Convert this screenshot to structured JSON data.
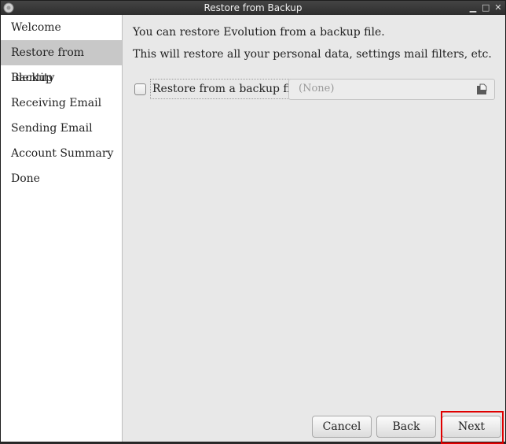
{
  "window": {
    "title": "Restore from Backup"
  },
  "sidebar": {
    "items": [
      {
        "label": "Welcome"
      },
      {
        "label": "Restore from Backup"
      },
      {
        "label": "Identity"
      },
      {
        "label": "Receiving Email"
      },
      {
        "label": "Sending Email"
      },
      {
        "label": "Account Summary"
      },
      {
        "label": "Done"
      }
    ]
  },
  "main": {
    "intro": "You can restore Evolution from a backup file.",
    "description": "This will restore all your personal data, settings mail filters, etc.",
    "restore_checkbox_label": "Restore from a backup file:",
    "file_chooser_value": "(None)"
  },
  "buttons": {
    "cancel": "Cancel",
    "back": "Back",
    "next": "Next"
  },
  "icons": {
    "app": "evolution-app-icon",
    "file": "document-open-icon"
  }
}
